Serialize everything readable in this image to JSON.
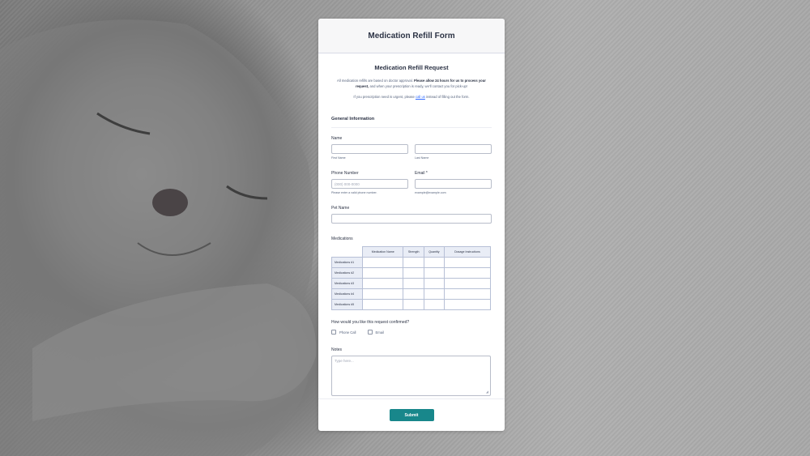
{
  "form": {
    "header_title": "Medication Refill Form",
    "subtitle": "Medication Refill Request",
    "intro_text_1": "All medication refills are based on doctor approval.",
    "intro_bold": "Please allow 24 hours for us to process your request,",
    "intro_text_2": "and when your prescription is ready, we'll contact you for pick-up!",
    "urgent_before": "If you prescription need is urgent, please",
    "urgent_link": "call us",
    "urgent_after": "instead of filling out the form."
  },
  "general": {
    "section_title": "General Information",
    "name_label": "Name",
    "first_name_hint": "First Name",
    "last_name_hint": "Last Name",
    "phone_label": "Phone Number",
    "phone_placeholder": "(000) 000-0000",
    "phone_hint": "Please enter a valid phone number.",
    "email_label": "Email *",
    "email_hint": "example@example.com",
    "pet_label": "Pet Name"
  },
  "medications": {
    "label": "Medications",
    "columns": [
      "Medication Name",
      "Strength",
      "Quantity",
      "Dosage Instructions"
    ],
    "rows": [
      "Medications #1",
      "Medications #2",
      "Medications #3",
      "Medications #4",
      "Medications #5"
    ]
  },
  "confirm": {
    "question": "How would you like this request confirmed?",
    "options": [
      "Phone Call",
      "Email"
    ]
  },
  "notes": {
    "label": "Notes",
    "placeholder": "Type here..."
  },
  "submit_label": "Submit"
}
